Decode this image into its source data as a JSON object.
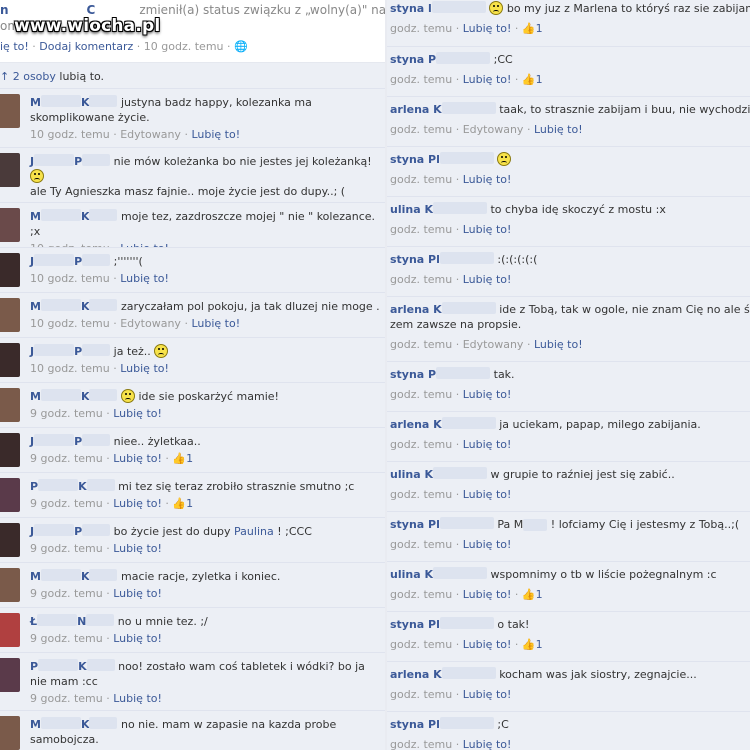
{
  "watermark": "www.wiocha.pl",
  "post": {
    "author_first": "n",
    "author_second": "C",
    "status_text": "zmienił(a) status związku z „wolny(a)\" na „to",
    "status_line2": "omp",
    "like_link": "ię to!",
    "sep": " · ",
    "add_comment": "Dodaj komentarz",
    "time": "10 godz. temu",
    "likes_prefix": "",
    "likes_link": "2 osoby",
    "likes_suffix": " lubią to."
  },
  "left_comments": [
    {
      "a1": "M",
      "a2": "K",
      "text": "justyna badz happy, kolezanka ma skomplikowane życie.",
      "time": "10 godz. temu",
      "edited": "Edytowany",
      "like": "Lubię to!",
      "count": "",
      "avatar": "#7a5a4a"
    },
    {
      "a1": "J",
      "a2": "P",
      "text": "nie mów koleżanka bo nie jestes jej koleżanką!",
      "smiley_after": true,
      "text2": "ale Ty Agnieszka masz fajnie.. moje życie jest do dupy..; (",
      "time": "10 godz. temu",
      "edited": "",
      "like": "Lubię to!",
      "count": "",
      "avatar": "#4a3a3a"
    },
    {
      "a1": "M",
      "a2": "K",
      "text": "moje tez, zazdroszcze mojej \" nie \" kolezance. ;x",
      "time": "10 godz. temu",
      "edited": "",
      "like": "Lubię to!",
      "count": "",
      "avatar": "#6a4a4a"
    },
    {
      "a1": "J",
      "a2": "P",
      "text": ";'''''''(",
      "time": "10 godz. temu",
      "edited": "",
      "like": "Lubię to!",
      "count": "",
      "avatar": "#3a2a2a"
    },
    {
      "a1": "M",
      "a2": "K",
      "text": "zaryczałam pol pokoju, ja tak dluzej nie moge .",
      "time": "10 godz. temu",
      "edited": "Edytowany",
      "like": "Lubię to!",
      "count": "",
      "avatar": "#7a5a4a"
    },
    {
      "a1": "J",
      "a2": "P",
      "text": "ja też..",
      "smiley_after": true,
      "time": "10 godz. temu",
      "edited": "",
      "like": "Lubię to!",
      "count": "",
      "avatar": "#3a2a2a"
    },
    {
      "a1": "M",
      "a2": "K",
      "text": "ide sie poskarżyć mamie!",
      "smiley_before": true,
      "time": "9 godz. temu",
      "edited": "",
      "like": "Lubię to!",
      "count": "",
      "avatar": "#7a5a4a"
    },
    {
      "a1": "J",
      "a2": "P",
      "text": "niee.. żyletkaa..",
      "time": "9 godz. temu",
      "edited": "",
      "like": "Lubię to!",
      "count": "1",
      "avatar": "#3a2a2a"
    },
    {
      "a1": "P",
      "a2": "K",
      "text": "mi tez się teraz zrobiło strasznie smutno ;c",
      "time": "9 godz. temu",
      "edited": "",
      "like": "Lubię to!",
      "count": "1",
      "avatar": "#5a3a4a"
    },
    {
      "a1": "J",
      "a2": "P",
      "text": "bo życie jest do dupy",
      "link": "Paulina",
      "text_after": " ! ;CCC",
      "time": "9 godz. temu",
      "edited": "",
      "like": "Lubię to!",
      "count": "",
      "avatar": "#3a2a2a"
    },
    {
      "a1": "M",
      "a2": "K",
      "text": "macie racje, zyletka i koniec.",
      "time": "9 godz. temu",
      "edited": "",
      "like": "Lubię to!",
      "count": "",
      "avatar": "#7a5a4a"
    },
    {
      "a1": "Ł",
      "a2": "N",
      "text": "no u mnie tez. ;/",
      "time": "9 godz. temu",
      "edited": "",
      "like": "Lubię to!",
      "count": "",
      "avatar": "#b04040"
    },
    {
      "a1": "P",
      "a2": "K",
      "text": "noo! zostało wam coś tabletek i wódki? bo ja nie mam :cc",
      "time": "9 godz. temu",
      "edited": "",
      "like": "Lubię to!",
      "count": "",
      "avatar": "#5a3a4a"
    },
    {
      "a1": "M",
      "a2": "K",
      "text": "no nie. mam w zapasie na kazda probe samobojcza.",
      "time": "9 godz. temu",
      "edited": "",
      "like": "Lubię to!",
      "count": "",
      "avatar": "#7a5a4a"
    }
  ],
  "right_comments": [
    {
      "a1": "styna l",
      "text": "bo my juz z Marlena to któryś raz sie zabijamy",
      "smiley_before": true,
      "time": "godz. temu",
      "edited": "",
      "like": "Lubię to!",
      "count": "1"
    },
    {
      "a1": "styna P",
      "text": ";CC",
      "time": "godz. temu",
      "edited": "",
      "like": "Lubię to!",
      "count": "1"
    },
    {
      "a1": "arlena K",
      "text": "taak, to strasznie zabijam i buu, nie wychodzi.",
      "time": "godz. temu",
      "edited": "Edytowany",
      "like": "Lubię to!",
      "count": ""
    },
    {
      "a1": "styna Pl",
      "text": "",
      "smiley_before": true,
      "time": "godz. temu",
      "edited": "",
      "like": "Lubię to!",
      "count": ""
    },
    {
      "a1": "ulina K",
      "text": "to chyba idę skoczyć z mostu :x",
      "time": "godz. temu",
      "edited": "",
      "like": "Lubię to!",
      "count": ""
    },
    {
      "a1": "styna Pl",
      "text": ":(:(:(:(:(",
      "time": "godz. temu",
      "edited": "",
      "like": "Lubię to!",
      "count": ""
    },
    {
      "a1": "arlena K",
      "text": "ide z Tobą, tak w ogole, nie znam Cię no ale śmieszysz",
      "text2": "zem zawsze na propsie.",
      "time": "godz. temu",
      "edited": "Edytowany",
      "like": "Lubię to!",
      "count": "",
      "tall": true
    },
    {
      "a1": "styna P",
      "text": "tak.",
      "time": "godz. temu",
      "edited": "",
      "like": "Lubię to!",
      "count": ""
    },
    {
      "a1": "arlena K",
      "text": "ja uciekam, papap, milego zabijania.",
      "time": "godz. temu",
      "edited": "",
      "like": "Lubię to!",
      "count": ""
    },
    {
      "a1": "ulina K",
      "text": "w grupie to raźniej jest się zabić..",
      "time": "godz. temu",
      "edited": "",
      "like": "Lubię to!",
      "count": ""
    },
    {
      "a1": "styna Pl",
      "text": "! lofciamy Cię i jestesmy z Tobą..;(",
      "prefix": "Pa M",
      "time": "godz. temu",
      "edited": "",
      "like": "Lubię to!",
      "count": ""
    },
    {
      "a1": "ulina K",
      "text": "wspomnimy o tb w liście pożegnalnym :c",
      "time": "godz. temu",
      "edited": "",
      "like": "Lubię to!",
      "count": "1"
    },
    {
      "a1": "styna Pl",
      "text": "o tak!",
      "time": "godz. temu",
      "edited": "",
      "like": "Lubię to!",
      "count": "1"
    },
    {
      "a1": "arlena K",
      "text": "kocham was jak siostry, zegnajcie...",
      "time": "godz. temu",
      "edited": "",
      "like": "Lubię to!",
      "count": ""
    },
    {
      "a1": "styna Pl",
      "text": ";C",
      "time": "godz. temu",
      "edited": "",
      "like": "Lubię to!",
      "count": ""
    }
  ],
  "icons": {
    "thumb": "thumbs-up-icon",
    "globe": "globe-icon",
    "smiley": "sad-smiley-icon"
  }
}
